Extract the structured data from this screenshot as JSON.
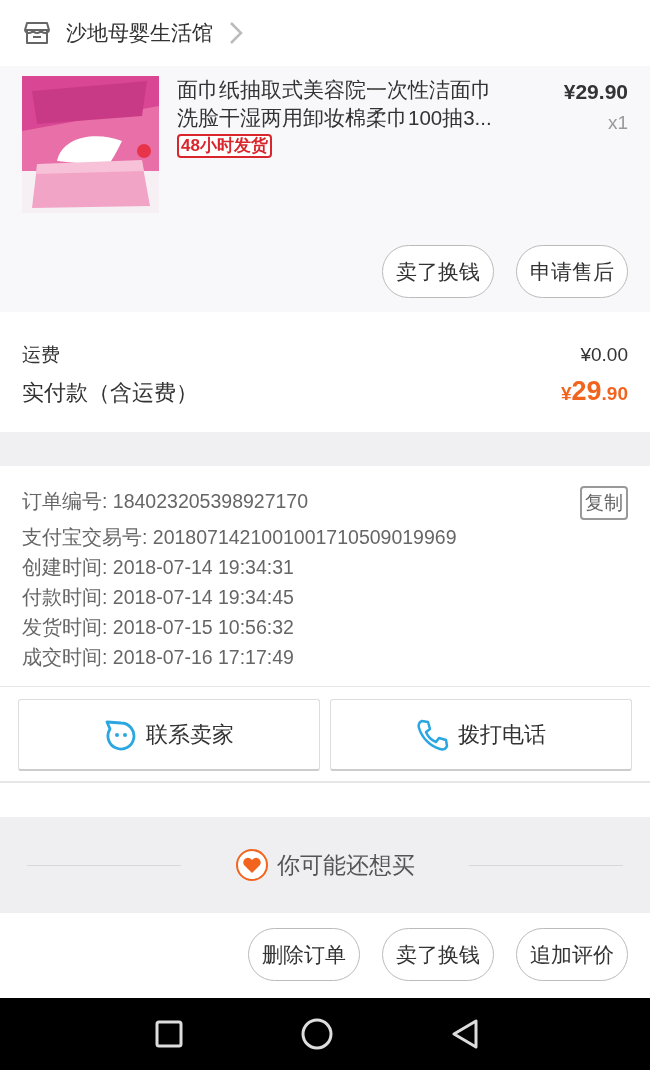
{
  "store": {
    "name": "沙地母婴生活馆"
  },
  "product": {
    "title": "面巾纸抽取式美容院一次性洁面巾洗脸干湿两用卸妆棉柔巾100抽3...",
    "price": "¥29.90",
    "quantity": "x1",
    "tag": "48小时发货"
  },
  "item_actions": [
    "卖了换钱",
    "申请售后"
  ],
  "summary": {
    "shipping_label": "运费",
    "shipping_value": "¥0.00",
    "total_label": "实付款（含运费）",
    "total_currency": "¥",
    "total_integer": "29",
    "total_decimal": ".90"
  },
  "order_info": {
    "copy_button": "复制",
    "rows": [
      {
        "label": "订单编号:",
        "value": "184023205398927170"
      },
      {
        "label": "支付宝交易号:",
        "value": "2018071421001001710509019969"
      },
      {
        "label": "创建时间:",
        "value": "2018-07-14 19:34:31"
      },
      {
        "label": "付款时间:",
        "value": "2018-07-14 19:34:45"
      },
      {
        "label": "发货时间:",
        "value": "2018-07-15 10:56:32"
      },
      {
        "label": "成交时间:",
        "value": "2018-07-16 17:17:49"
      }
    ]
  },
  "contact": [
    {
      "kind": "chat",
      "label": "联系卖家"
    },
    {
      "kind": "phone",
      "label": "拨打电话"
    }
  ],
  "recommend": {
    "title": "你可能还想买"
  },
  "order_actions": [
    "删除订单",
    "卖了换钱",
    "追加评价"
  ]
}
